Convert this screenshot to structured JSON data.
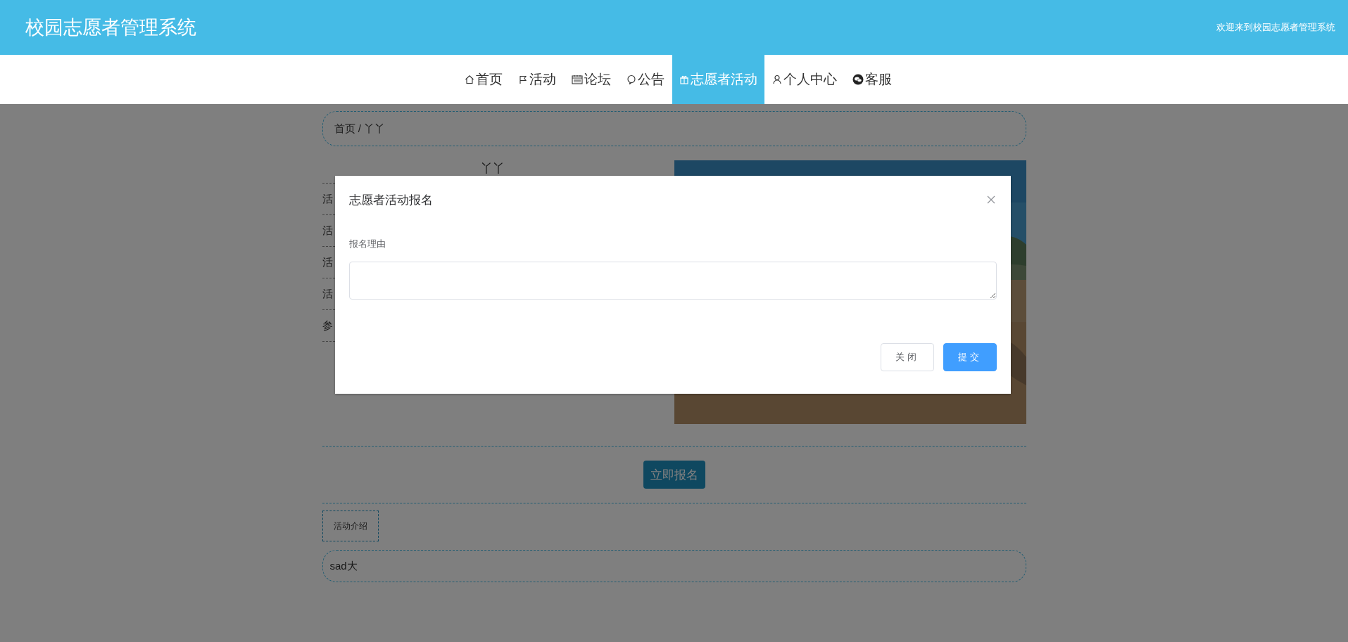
{
  "header": {
    "title": "校园志愿者管理系统",
    "welcome": "欢迎来到校园志愿者管理系统"
  },
  "nav": [
    {
      "label": "首页",
      "selected": false
    },
    {
      "label": "活动",
      "selected": false
    },
    {
      "label": "论坛",
      "selected": false
    },
    {
      "label": "公告",
      "selected": false
    },
    {
      "label": "志愿者活动",
      "selected": true
    },
    {
      "label": "个人中心",
      "selected": false
    },
    {
      "label": "客服",
      "selected": false
    }
  ],
  "breadcrumb": "首页 / 丫丫",
  "activity": {
    "title": "丫丫",
    "fields": [
      "活",
      "活",
      "活",
      "活",
      "参"
    ]
  },
  "signup_button": "立即报名",
  "tabs": [
    {
      "label": "活动介绍",
      "selected": true
    }
  ],
  "intro": "sad大",
  "dialog": {
    "title": "志愿者活动报名",
    "label": "报名理由",
    "buttons": [
      {
        "label": "关闭",
        "kind": "default"
      },
      {
        "label": "提交",
        "kind": "primary"
      }
    ]
  }
}
